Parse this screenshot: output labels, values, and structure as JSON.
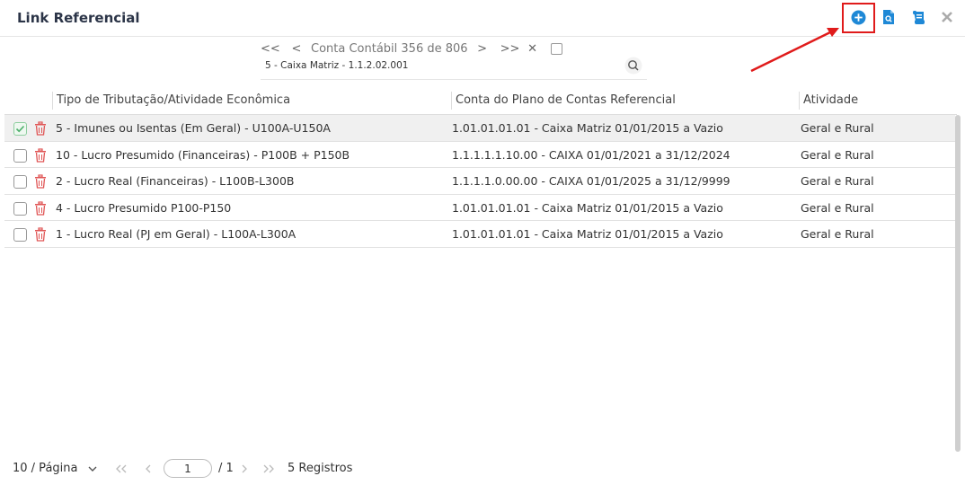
{
  "dialog": {
    "title": "Link Referencial"
  },
  "navigator": {
    "first": "<<",
    "prev": "<",
    "label": "Conta Contábil 356 de 806",
    "next": ">",
    "last": ">>",
    "clear": "✕",
    "account": "5 - Caixa Matriz  - 1.1.2.02.001"
  },
  "table": {
    "columns": [
      "Tipo de Tributação/Atividade Econômica",
      "Conta do Plano de Contas Referencial",
      "Atividade"
    ],
    "rows": [
      {
        "tipo": "5 - Imunes ou Isentas (Em Geral) - U100A-U150A",
        "conta": "1.01.01.01.01 - Caixa Matriz 01/01/2015 a Vazio",
        "atividade": "Geral e Rural",
        "checked": true
      },
      {
        "tipo": "10 - Lucro Presumido (Financeiras) - P100B + P150B",
        "conta": "1.1.1.1.1.10.00 - CAIXA 01/01/2021 a 31/12/2024",
        "atividade": "Geral e Rural",
        "checked": false
      },
      {
        "tipo": "2 - Lucro Real (Financeiras) - L100B-L300B",
        "conta": "1.1.1.1.0.00.00 - CAIXA 01/01/2025 a 31/12/9999",
        "atividade": "Geral e Rural",
        "checked": false
      },
      {
        "tipo": "4 - Lucro Presumido P100-P150",
        "conta": "1.01.01.01.01 - Caixa Matriz 01/01/2015 a Vazio",
        "atividade": "Geral e Rural",
        "checked": false
      },
      {
        "tipo": "1 - Lucro Real (PJ em Geral) - L100A-L300A",
        "conta": "1.01.01.01.01 - Caixa Matriz 01/01/2015 a Vazio",
        "atividade": "Geral e Rural",
        "checked": false
      }
    ]
  },
  "pagination": {
    "page_size": "10 / Página",
    "current_page": "1",
    "total_pages": "/ 1",
    "records": "5 Registros"
  },
  "colors": {
    "accent": "#1e88d6",
    "highlight": "#e01b1b",
    "danger": "#e05555"
  },
  "icons": [
    "add-circle-icon",
    "document-search-icon",
    "scroll-icon",
    "close-icon",
    "search-icon",
    "trash-icon",
    "chevron-down-icon"
  ]
}
